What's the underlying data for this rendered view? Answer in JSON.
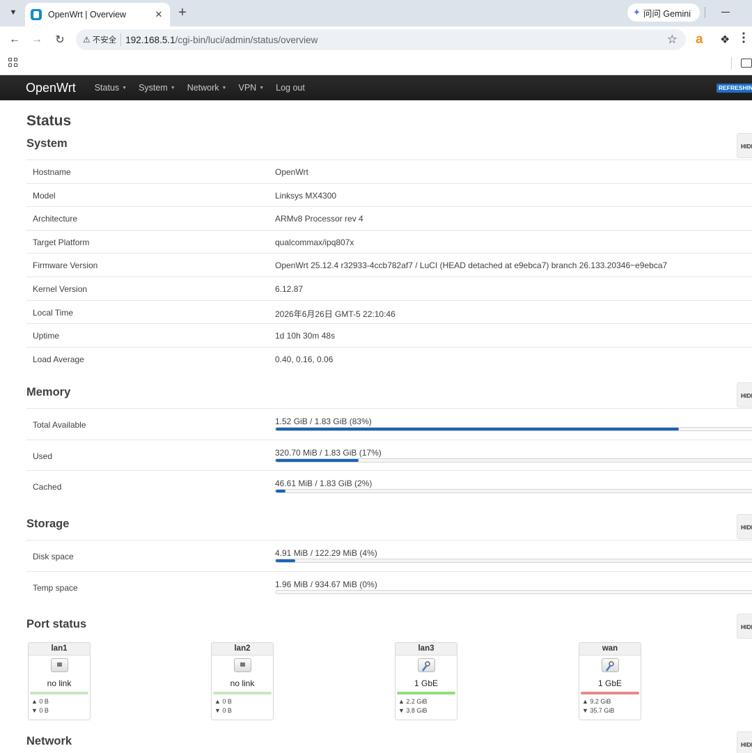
{
  "browser": {
    "tab_title": "OpenWrt | Overview",
    "tab_close": "✕",
    "new_tab": "+",
    "gemini_label": "问问 Gemini",
    "security_label": "不安全",
    "url_host": "192.168.5.1",
    "url_path": "/cgi-bin/luci/admin/status/overview",
    "extension_label": "a"
  },
  "header": {
    "brand": "OpenWrt",
    "menu": [
      {
        "label": "Status"
      },
      {
        "label": "System"
      },
      {
        "label": "Network"
      },
      {
        "label": "VPN"
      },
      {
        "label": "Log out"
      }
    ],
    "refresh_badge": "REFRESHING"
  },
  "page": {
    "title": "Status",
    "hide_label": "HIDE"
  },
  "system": {
    "title": "System",
    "rows": [
      {
        "key": "Hostname",
        "value": "OpenWrt"
      },
      {
        "key": "Model",
        "value": "Linksys MX4300"
      },
      {
        "key": "Architecture",
        "value": "ARMv8 Processor rev 4"
      },
      {
        "key": "Target Platform",
        "value": "qualcommax/ipq807x"
      },
      {
        "key": "Firmware Version",
        "value": "OpenWrt 25.12.4 r32933-4ccb782af7 / LuCI (HEAD detached at e9ebca7) branch 26.133.20346~e9ebca7"
      },
      {
        "key": "Kernel Version",
        "value": "6.12.87"
      },
      {
        "key": "Local Time",
        "value": "2026年6月26日 GMT-5 22:10:46"
      },
      {
        "key": "Uptime",
        "value": "1d 10h 30m 48s"
      },
      {
        "key": "Load Average",
        "value": "0.40, 0.16, 0.06"
      }
    ]
  },
  "memory": {
    "title": "Memory",
    "rows": [
      {
        "key": "Total Available",
        "value": "1.52 GiB / 1.83 GiB (83%)",
        "percent": 83
      },
      {
        "key": "Used",
        "value": "320.70 MiB / 1.83 GiB (17%)",
        "percent": 17
      },
      {
        "key": "Cached",
        "value": "46.61 MiB / 1.83 GiB (2%)",
        "percent": 2
      }
    ]
  },
  "storage": {
    "title": "Storage",
    "rows": [
      {
        "key": "Disk space",
        "value": "4.91 MiB / 122.29 MiB (4%)",
        "percent": 4
      },
      {
        "key": "Temp space",
        "value": "1.96 MiB / 934.67 MiB (0%)",
        "percent": 0
      }
    ]
  },
  "ports": {
    "title": "Port status",
    "items": [
      {
        "name": "lan1",
        "speed": "no link",
        "connected": false,
        "line_color": "#c8e6c0",
        "tx": "▲ 0 B",
        "rx": "▼ 0 B"
      },
      {
        "name": "lan2",
        "speed": "no link",
        "connected": false,
        "line_color": "#c8e6c0",
        "tx": "▲ 0 B",
        "rx": "▼ 0 B"
      },
      {
        "name": "lan3",
        "speed": "1 GbE",
        "connected": true,
        "line_color": "#8ee07a",
        "tx": "▲ 2.2 GiB",
        "rx": "▼ 3.8 GiB"
      },
      {
        "name": "wan",
        "speed": "1 GbE",
        "connected": true,
        "line_color": "#e88a8a",
        "tx": "▲ 9.2 GiB",
        "rx": "▼ 35.7 GiB"
      }
    ]
  },
  "network": {
    "title": "Network"
  }
}
